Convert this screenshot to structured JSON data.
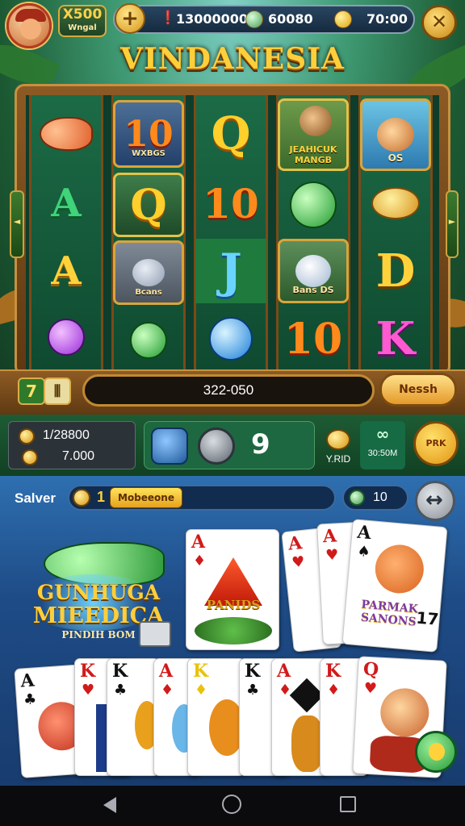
{
  "hud": {
    "level_top": "X500",
    "level_bottom": "Wngal",
    "plus_label": "+",
    "balance_1": "13000000",
    "balance_2": "60080",
    "balance_3": "70:00",
    "settings_glyph": "✕"
  },
  "title": "VINDANESIA",
  "reels": {
    "col1": [
      "fish",
      "A",
      "A",
      "orb"
    ],
    "col2": [
      "10",
      "Q",
      "bird",
      "orb"
    ],
    "col3": [
      "Q",
      "10",
      "J",
      "orb"
    ],
    "col4": [
      "monkey",
      "orb",
      "bird",
      "10"
    ],
    "col5": [
      "squirrel",
      "bowl",
      "D",
      "K"
    ],
    "sym_10_caption": "WXBGS",
    "sym_monkey_caption": "JEAHICUK MANGB",
    "sym_bird_caption": "Bcans",
    "sym_bird2_caption": "Bans DS",
    "sym_squirrel_caption": "OS"
  },
  "side_buttons": {
    "left": "◄",
    "right": "►"
  },
  "bet": {
    "left_square_1": "7",
    "left_square_2": "⦀",
    "field_value": "322-050",
    "next_label": "Nessh"
  },
  "stats": {
    "row1": "1/28800",
    "row2": "7.000",
    "count": "9",
    "small_label": "Y.RID",
    "infinity": "∞",
    "timer": "30:50M",
    "spin_label": "PRK"
  },
  "lower": {
    "salver_label": "Salver",
    "bet_num": "1",
    "tag": "Mobeeone",
    "pill_value": "10",
    "back_glyph": "↔"
  },
  "logo": {
    "line1": "GUNHUGA",
    "line2": "MIEEDICA",
    "line3": "PINDIH BOM"
  },
  "cards": {
    "center": {
      "rank": "A",
      "suit": "♦",
      "text": "PANIDS"
    },
    "fan_top": [
      {
        "rank": "A",
        "suit": "♥"
      },
      {
        "rank": "A",
        "suit": "♥"
      },
      {
        "rank": "A",
        "suit": "♠"
      }
    ],
    "fan_top_text": "PARMAK SANONS",
    "fan_top_num": "17",
    "bottom": [
      {
        "rank": "A",
        "suit": "♣"
      },
      {
        "rank": "K",
        "suit": "♥"
      },
      {
        "rank": "K",
        "suit": "♣"
      },
      {
        "rank": "A",
        "suit": "♦"
      },
      {
        "rank": "K",
        "suit": "♦"
      },
      {
        "rank": "K",
        "suit": "♣"
      },
      {
        "rank": "A",
        "suit": "♦"
      },
      {
        "rank": "K",
        "suit": "♦"
      },
      {
        "rank": "Q",
        "suit": "♥"
      }
    ]
  },
  "nav": {
    "back": "back-icon",
    "home": "home-icon",
    "recents": "recents-icon"
  },
  "colors": {
    "title": "#ffcf3a",
    "frame_wood": "#8c5a24",
    "lower_panel": "#1e4b86",
    "stats_panel": "#1d5c34"
  }
}
